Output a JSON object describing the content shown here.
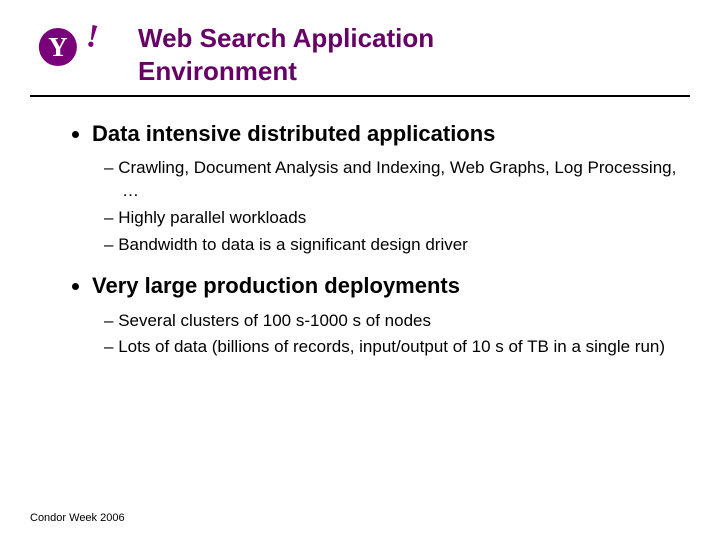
{
  "header": {
    "title_line1": "Web Search Application",
    "title_line2": "Environment"
  },
  "content": {
    "bullets": [
      {
        "text": "Data intensive distributed applications",
        "sub": [
          "Crawling, Document Analysis and Indexing, Web Graphs, Log Processing, …",
          "Highly parallel workloads",
          "Bandwidth to data is a significant design driver"
        ]
      },
      {
        "text": "Very large production deployments",
        "sub": [
          "Several clusters of 100 s-1000 s of nodes",
          "Lots of data (billions of records, input/output of 10 s of TB in a single run)"
        ]
      }
    ]
  },
  "footer": {
    "text": "Condor Week 2006"
  }
}
